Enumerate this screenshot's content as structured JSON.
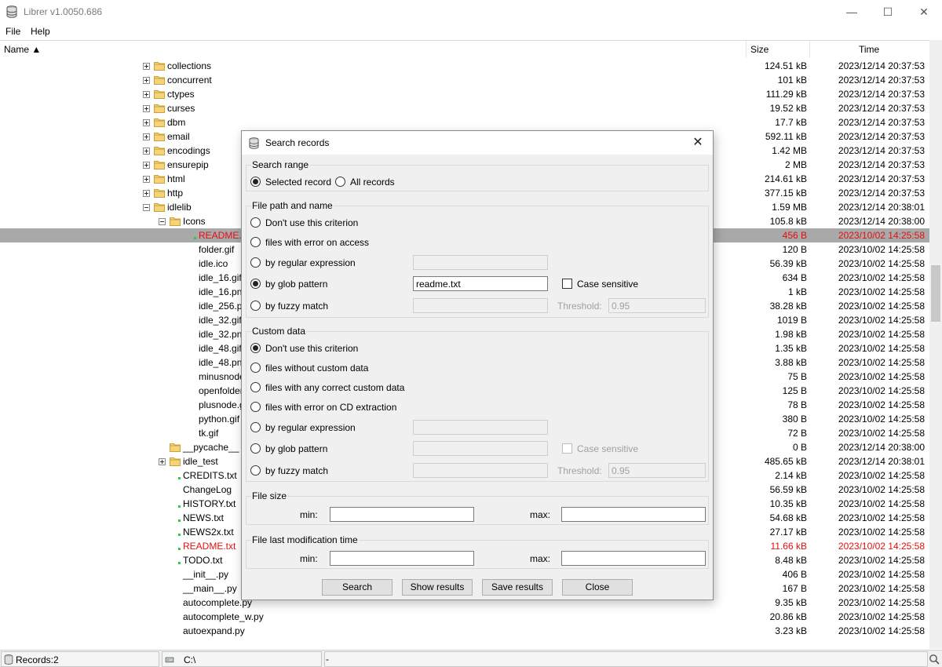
{
  "window": {
    "title": "Librer v1.0050.686"
  },
  "menu": [
    "File",
    "Help"
  ],
  "columns": {
    "name": "Name ▲",
    "size": "Size",
    "time": "Time"
  },
  "rows": [
    {
      "name": "collections",
      "size": "124.51 kB",
      "time": "2023/12/14 20:37:53"
    },
    {
      "name": "concurrent",
      "size": "101 kB",
      "time": "2023/12/14 20:37:53"
    },
    {
      "name": "ctypes",
      "size": "111.29 kB",
      "time": "2023/12/14 20:37:53"
    },
    {
      "name": "curses",
      "size": "19.52 kB",
      "time": "2023/12/14 20:37:53"
    },
    {
      "name": "dbm",
      "size": "17.7 kB",
      "time": "2023/12/14 20:37:53"
    },
    {
      "name": "email",
      "size": "592.11 kB",
      "time": "2023/12/14 20:37:53"
    },
    {
      "name": "encodings",
      "size": "1.42 MB",
      "time": "2023/12/14 20:37:53"
    },
    {
      "name": "ensurepip",
      "size": "2 MB",
      "time": "2023/12/14 20:37:53"
    },
    {
      "name": "html",
      "size": "214.61 kB",
      "time": "2023/12/14 20:37:53"
    },
    {
      "name": "http",
      "size": "377.15 kB",
      "time": "2023/12/14 20:37:53"
    },
    {
      "name": "idlelib",
      "size": "1.59 MB",
      "time": "2023/12/14 20:38:01"
    },
    {
      "name": "Icons",
      "size": "105.8 kB",
      "time": "2023/12/14 20:38:00"
    },
    {
      "name": "README.txt",
      "size": "456 B",
      "time": "2023/10/02 14:25:58"
    },
    {
      "name": "folder.gif",
      "size": "120 B",
      "time": "2023/10/02 14:25:58"
    },
    {
      "name": "idle.ico",
      "size": "56.39 kB",
      "time": "2023/10/02 14:25:58"
    },
    {
      "name": "idle_16.gif",
      "size": "634 B",
      "time": "2023/10/02 14:25:58"
    },
    {
      "name": "idle_16.png",
      "size": "1 kB",
      "time": "2023/10/02 14:25:58"
    },
    {
      "name": "idle_256.png",
      "size": "38.28 kB",
      "time": "2023/10/02 14:25:58"
    },
    {
      "name": "idle_32.gif",
      "size": "1019 B",
      "time": "2023/10/02 14:25:58"
    },
    {
      "name": "idle_32.png",
      "size": "1.98 kB",
      "time": "2023/10/02 14:25:58"
    },
    {
      "name": "idle_48.gif",
      "size": "1.35 kB",
      "time": "2023/10/02 14:25:58"
    },
    {
      "name": "idle_48.png",
      "size": "3.88 kB",
      "time": "2023/10/02 14:25:58"
    },
    {
      "name": "minusnode.gif",
      "size": "75 B",
      "time": "2023/10/02 14:25:58"
    },
    {
      "name": "openfolder.gif",
      "size": "125 B",
      "time": "2023/10/02 14:25:58"
    },
    {
      "name": "plusnode.gif",
      "size": "78 B",
      "time": "2023/10/02 14:25:58"
    },
    {
      "name": "python.gif",
      "size": "380 B",
      "time": "2023/10/02 14:25:58"
    },
    {
      "name": "tk.gif",
      "size": "72 B",
      "time": "2023/10/02 14:25:58"
    },
    {
      "name": "__pycache__",
      "size": "0 B",
      "time": "2023/12/14 20:38:00"
    },
    {
      "name": "idle_test",
      "size": "485.65 kB",
      "time": "2023/12/14 20:38:01"
    },
    {
      "name": "CREDITS.txt",
      "size": "2.14 kB",
      "time": "2023/10/02 14:25:58"
    },
    {
      "name": "ChangeLog",
      "size": "56.59 kB",
      "time": "2023/10/02 14:25:58"
    },
    {
      "name": "HISTORY.txt",
      "size": "10.35 kB",
      "time": "2023/10/02 14:25:58"
    },
    {
      "name": "NEWS.txt",
      "size": "54.68 kB",
      "time": "2023/10/02 14:25:58"
    },
    {
      "name": "NEWS2x.txt",
      "size": "27.17 kB",
      "time": "2023/10/02 14:25:58"
    },
    {
      "name": "README.txt",
      "size": "11.66 kB",
      "time": "2023/10/02 14:25:58"
    },
    {
      "name": "TODO.txt",
      "size": "8.48 kB",
      "time": "2023/10/02 14:25:58"
    },
    {
      "name": "__init__.py",
      "size": "406 B",
      "time": "2023/10/02 14:25:58"
    },
    {
      "name": "__main__.py",
      "size": "167 B",
      "time": "2023/10/02 14:25:58"
    },
    {
      "name": "autocomplete.py",
      "size": "9.35 kB",
      "time": "2023/10/02 14:25:58"
    },
    {
      "name": "autocomplete_w.py",
      "size": "20.86 kB",
      "time": "2023/10/02 14:25:58"
    },
    {
      "name": "autoexpand.py",
      "size": "3.23 kB",
      "time": "2023/10/02 14:25:58"
    }
  ],
  "status": {
    "records": "Records:2",
    "path": "C:\\",
    "info": "-"
  },
  "dialog": {
    "title": "Search records",
    "search_range": {
      "legend": "Search range",
      "selected": "Selected record",
      "all": "All records"
    },
    "file_path": {
      "legend": "File path and name",
      "opt_none": "Don't use this criterion",
      "opt_error": "files with error on access",
      "opt_regex": "by regular expression",
      "opt_glob": "by glob pattern",
      "opt_fuzzy": "by fuzzy match",
      "glob_value": "readme.txt",
      "case_sensitive": "Case sensitive",
      "threshold_label": "Threshold:",
      "threshold_value": "0.95"
    },
    "custom_data": {
      "legend": "Custom data",
      "opt_none": "Don't use this criterion",
      "opt_without": "files without custom data",
      "opt_any": "files with any correct custom data",
      "opt_cd_error": "files with error on CD extraction",
      "opt_regex": "by regular expression",
      "opt_glob": "by glob pattern",
      "opt_fuzzy": "by fuzzy match",
      "case_sensitive": "Case sensitive",
      "threshold_label": "Threshold:",
      "threshold_value": "0.95"
    },
    "file_size": {
      "legend": "File size",
      "min": "min:",
      "max": "max:"
    },
    "mod_time": {
      "legend": "File last modification time",
      "min": "min:",
      "max": "max:"
    },
    "buttons": {
      "search": "Search",
      "show": "Show results",
      "save": "Save results",
      "close": "Close"
    }
  }
}
